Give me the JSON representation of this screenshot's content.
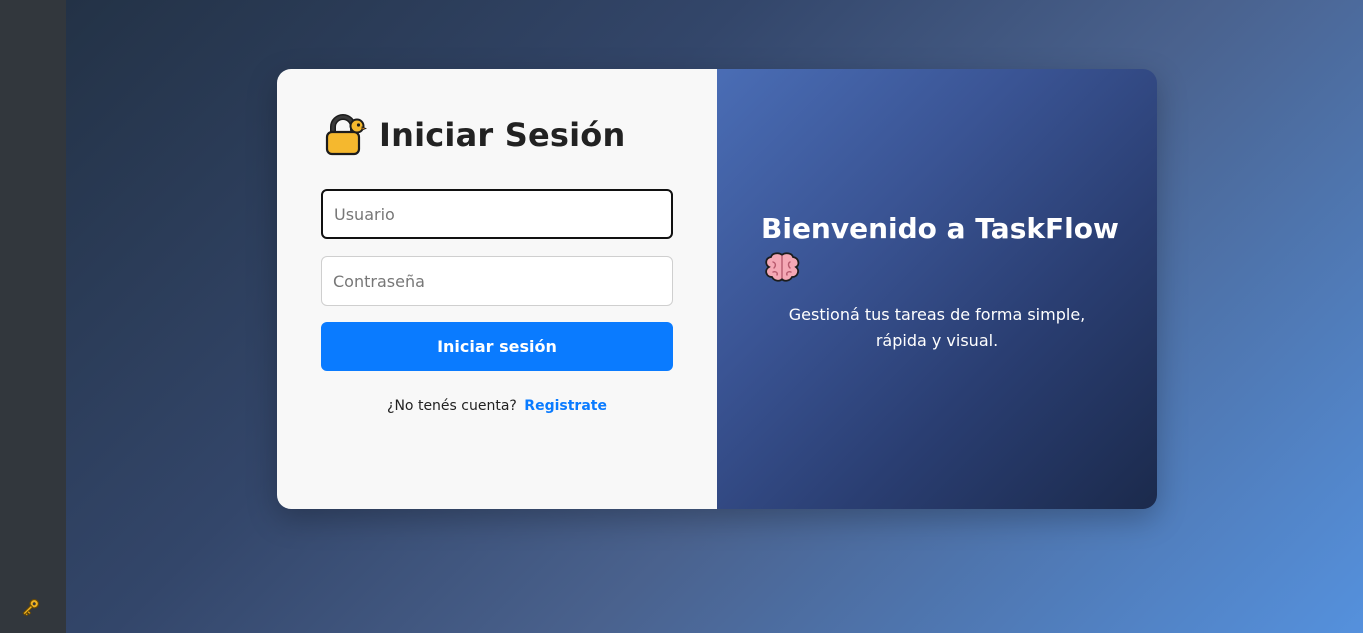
{
  "sidebar": {
    "icon": "key-icon"
  },
  "login": {
    "title": "Iniciar Sesión",
    "title_icon": "lock-icon",
    "username_placeholder": "Usuario",
    "username_value": "",
    "password_placeholder": "Contraseña",
    "password_value": "",
    "submit_label": "Iniciar sesión",
    "register_prompt": "¿No tenés cuenta?",
    "register_link": "Registrate"
  },
  "welcome": {
    "title": "Bienvenido a TaskFlow",
    "title_icon": "brain-icon",
    "subtitle": "Gestioná tus tareas de forma simple, rápida y visual."
  },
  "colors": {
    "accent": "#0a7bff",
    "panel_left": "#f8f8f8",
    "panel_right_start": "#4a6db5",
    "panel_right_end": "#1b2a4c",
    "sidebar": "#32373d"
  }
}
